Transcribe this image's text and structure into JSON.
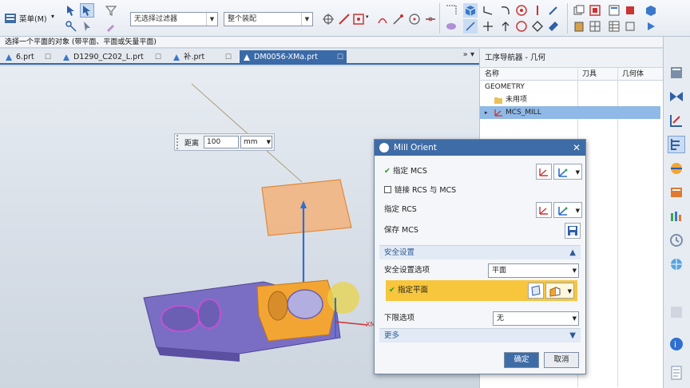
{
  "toolbar": {
    "menu_label": "菜单(M)",
    "selection_filter": "无选择过滤器",
    "selection_scope": "整个装配"
  },
  "status_line": "选择一个平面的对象 (带平面、平面或矢量平面)",
  "tabs": [
    {
      "label": "6.prt",
      "active": false
    },
    {
      "label": "D1290_C202_L.prt",
      "active": false
    },
    {
      "label": "补.prt",
      "active": false
    },
    {
      "label": "DM0056-XMa.prt",
      "active": true
    }
  ],
  "tabs_more": "» ▾",
  "distance_box": {
    "label": "距离",
    "value": "100",
    "unit": "mm"
  },
  "navigator": {
    "title": "工序导航器 - 几何",
    "columns": [
      "名称",
      "刀具",
      "几何体"
    ],
    "rows": [
      {
        "label": "GEOMETRY",
        "level": 0,
        "selected": false
      },
      {
        "label": "未用项",
        "level": 1,
        "selected": false
      },
      {
        "label": "MCS_MILL",
        "level": 1,
        "selected": true
      }
    ]
  },
  "dialog": {
    "title": "Mill Orient",
    "specify_mcs": "指定 MCS",
    "link_rcs_mcs": "链接 RCS 与 MCS",
    "specify_rcs": "指定 RCS",
    "save_mcs": "保存 MCS",
    "safety_group": "安全设置",
    "safety_option_label": "安全设置选项",
    "safety_option_value": "平面",
    "specify_plane": "指定平面",
    "lower_limit_label": "下限选项",
    "lower_limit_value": "无",
    "more_group": "更多",
    "ok_label": "确定",
    "cancel_label": "取消"
  },
  "colors": {
    "title_bar": "#3e6ca6",
    "highlight_row": "#f7c63d",
    "part_purple": "#7a6ec4",
    "part_orange": "#f3a533",
    "plane_orange": "#f2b17a",
    "selected_row": "#8fb9e6"
  },
  "icons": [
    "search-icon",
    "selection-icon",
    "wcs-icon",
    "csys-icon",
    "save-icon",
    "navigator-icon",
    "help-icon"
  ]
}
